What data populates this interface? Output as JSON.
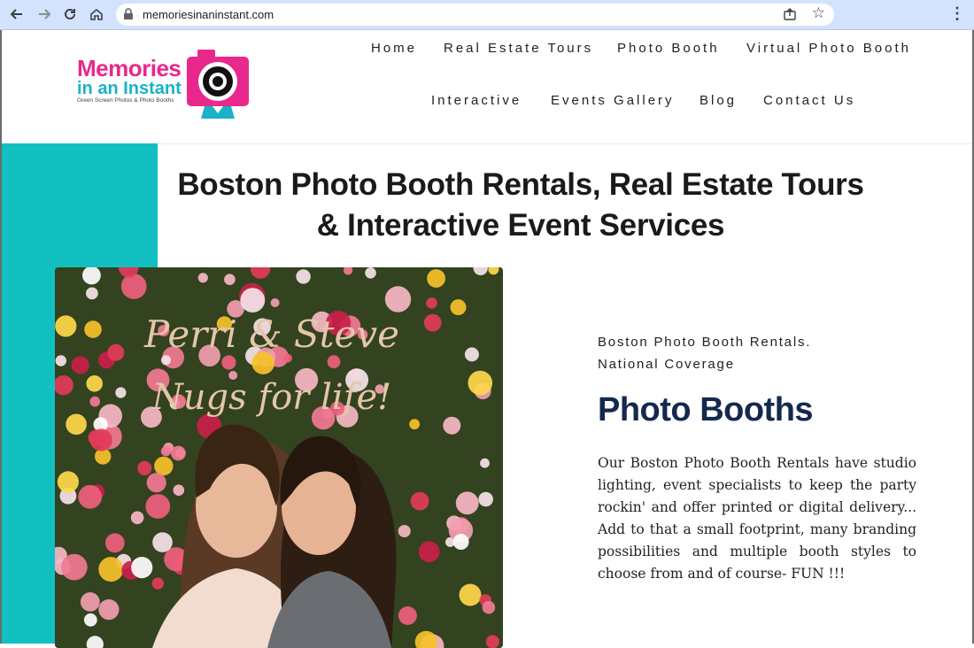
{
  "browser": {
    "url": "memoriesinaninstant.com"
  },
  "logo": {
    "line1": "Memories",
    "line2": "in an Instant",
    "tagline": "Green Screen Photos & Photo Booths"
  },
  "nav": {
    "row1": [
      "Home",
      "Real Estate Tours",
      "Photo Booth",
      "Virtual Photo Booth"
    ],
    "row2": [
      "Interactive",
      "Events Gallery",
      "Blog",
      "Contact Us"
    ]
  },
  "hero": {
    "title_line1": "Boston Photo Booth Rentals, Real Estate Tours",
    "title_line2": "& Interactive Event Services"
  },
  "photo": {
    "sign_line1": "Perri & Steve",
    "sign_line2": "Nugs for life!"
  },
  "section": {
    "subtitle_line1": "Boston Photo Booth Rentals.",
    "subtitle_line2": "National Coverage",
    "heading": "Photo Booths",
    "body": "Our Boston Photo Booth Rentals have studio lighting, event specialists to keep the party rockin' and offer printed or digital delivery... Add to that a small footprint, many branding possibilities and multiple booth styles to choose from and of course- FUN !!!"
  },
  "colors": {
    "accent_teal": "#13c0c1",
    "brand_pink": "#e8288c",
    "heading_navy": "#15294f",
    "chrome_blue": "#d3e3fd"
  }
}
